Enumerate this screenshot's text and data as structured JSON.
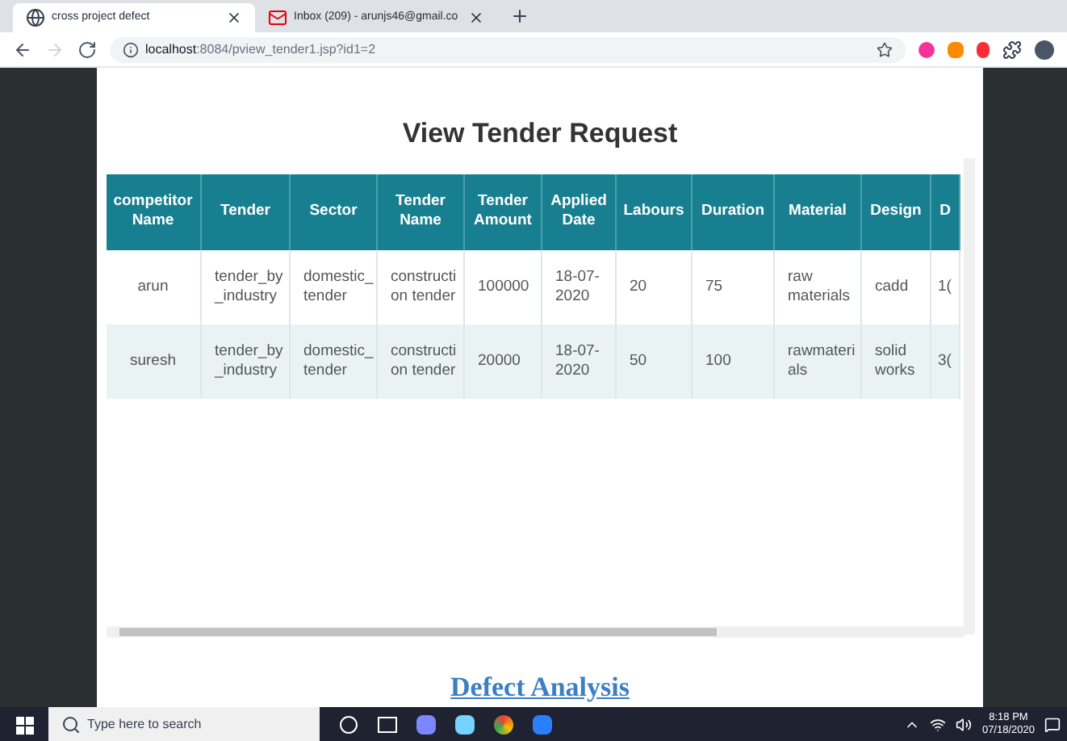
{
  "browser": {
    "tabs": [
      {
        "title": "cross project defect",
        "selected": true,
        "kind": "globe"
      },
      {
        "title": "Inbox (209) - arunjs46@gmail.co",
        "selected": false,
        "kind": "mail"
      }
    ],
    "address": {
      "host": "localhost",
      "rest": ":8084/pview_tender1.jsp?id1=2"
    }
  },
  "page": {
    "title": "View Tender Request",
    "table": {
      "columns": [
        "competitor\nName",
        "Tender",
        "Sector",
        "Tender\nName",
        "Tender\nAmount",
        "Applied\nDate",
        "Labours",
        "Duration",
        "Material",
        "Design",
        "D"
      ],
      "rows": [
        [
          "arun",
          "tender_by\n_industry",
          "domestic_\ntender",
          "constructi\non tender",
          "100000",
          "18-07-\n2020",
          "20",
          "75",
          "raw\nmaterials",
          "cadd",
          "1("
        ],
        [
          "suresh",
          "tender_by\n_industry",
          "domestic_\ntender",
          "constructi\non tender",
          "20000",
          "18-07-\n2020",
          "50",
          "100",
          "rawmateri\nals",
          "solid\nworks",
          "3("
        ]
      ]
    },
    "link": "Defect Analysis"
  },
  "taskbar": {
    "search_placeholder": "Type here to search",
    "time": "8:18 PM",
    "date": "07/18/2020"
  }
}
